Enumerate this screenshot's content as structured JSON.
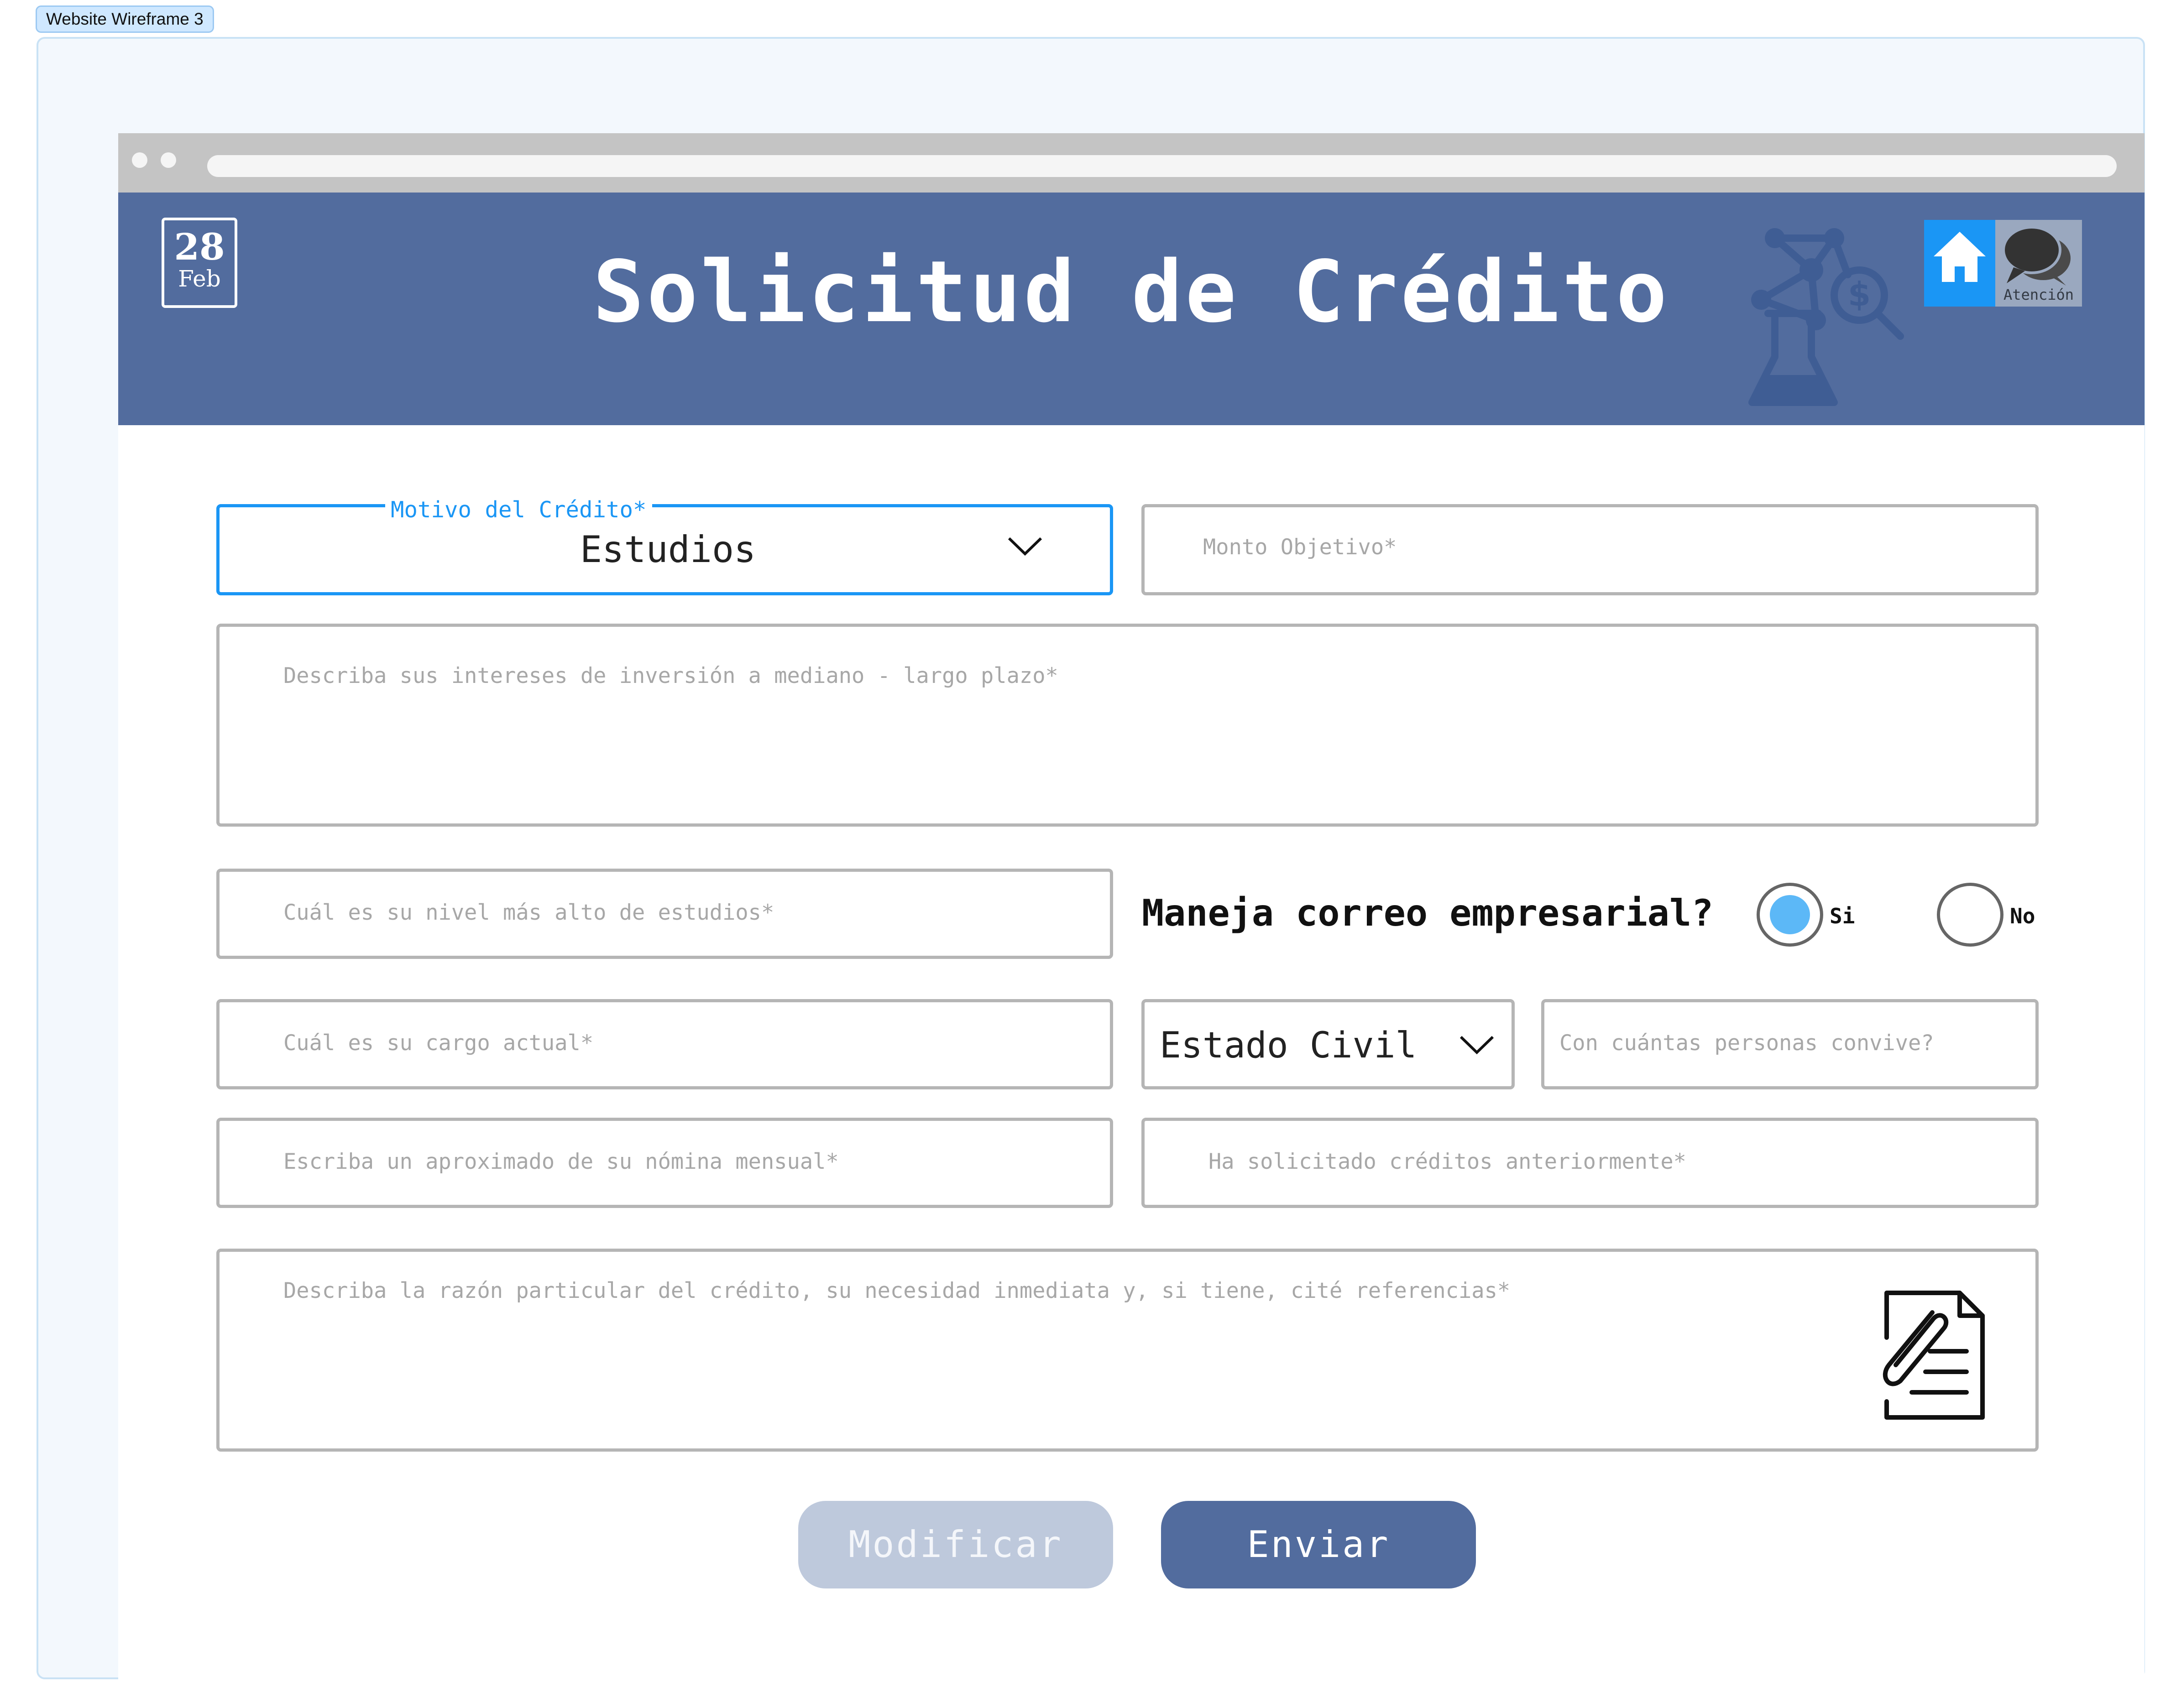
{
  "frame_label": "Website Wireframe 3",
  "header": {
    "date_day": "28",
    "date_month": "Feb",
    "title": "Solicitud de Crédito",
    "attention_label": "Atención"
  },
  "form": {
    "motivo": {
      "label": "Motivo del Crédito*",
      "value": "Estudios"
    },
    "monto_placeholder": "Monto Objetivo*",
    "intereses_placeholder": "Describa sus intereses de inversión a mediano - largo plazo*",
    "estudios_placeholder": "Cuál es su nivel más alto de estudios*",
    "correo_question": "Maneja correo empresarial?",
    "radio_si": "Si",
    "radio_no": "No",
    "radio_selected": "Si",
    "cargo_placeholder": "Cuál es su cargo actual*",
    "estado_civil": "Estado Civil",
    "convive_placeholder": "Con cuántas personas convive?",
    "nomina_placeholder": "Escriba un aproximado de su nómina mensual*",
    "creditos_placeholder": "Ha solicitado créditos anteriormente*",
    "razon_placeholder": "Describa la razón particular del crédito, su necesidad inmediata y, si tiene, cité referencias*"
  },
  "buttons": {
    "modify": "Modificar",
    "send": "Enviar"
  },
  "icons": {
    "home": "home-icon",
    "attention": "chat-bubbles-icon",
    "hero": "finance-lab-icon",
    "attach": "document-attach-icon",
    "dropdown": "chevron-down-icon"
  },
  "colors": {
    "header_bg": "#526c9e",
    "accent": "#1a96f5",
    "button_primary": "#526c9e",
    "button_disabled": "#bec9dc"
  }
}
